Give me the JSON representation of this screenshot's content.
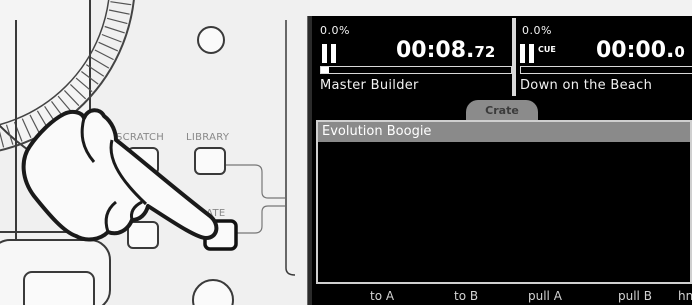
{
  "controller": {
    "labels": {
      "scratch": "SCRATCH",
      "library": "LIBRARY",
      "crate": "CRATE"
    }
  },
  "screen": {
    "deck_a": {
      "pitch": "0.0%",
      "time_main": "00:08.",
      "time_ms": "72",
      "track": "Master Builder",
      "state": "playing"
    },
    "deck_b": {
      "pitch": "0.0%",
      "cue_label": "CUE",
      "time_main": "00:00.",
      "time_ms": "0",
      "track": "Down on the Beach",
      "state": "cued"
    },
    "tab": {
      "label": "Crate"
    },
    "crate": {
      "items": [
        "Evolution Boogie"
      ]
    },
    "softkeys": {
      "to_a": "to A",
      "to_b": "to B",
      "pull_a": "pull A",
      "pull_b": "pull B",
      "extra": "hn"
    }
  }
}
